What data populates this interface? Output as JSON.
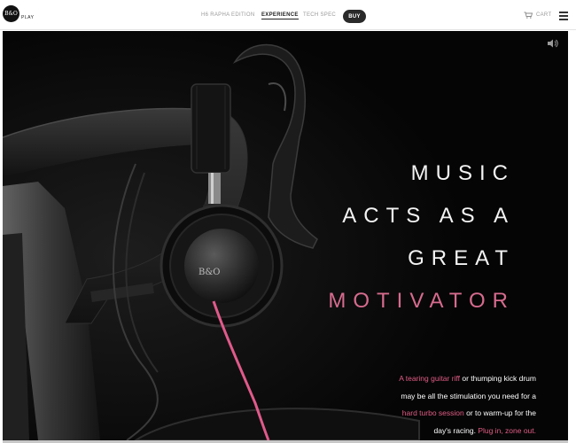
{
  "brand": {
    "logo_mark": "B&O",
    "logo_text": "PLAY"
  },
  "nav": {
    "items": [
      {
        "label": "H6 RAPHA EDITION",
        "active": false
      },
      {
        "label": "EXPERIENCE",
        "active": true
      },
      {
        "label": "TECH SPEC",
        "active": false
      }
    ],
    "buy_label": "BUY",
    "cart_label": "CART"
  },
  "hero": {
    "headline": [
      "MUSIC",
      "ACTS AS A",
      "GREAT",
      "MOTIVATOR"
    ],
    "headline_accent_line": "MOTIVATOR",
    "earcup_logo": "B&O",
    "body_segments": [
      {
        "text": "A tearing guitar riff",
        "accent": true
      },
      {
        "text": " or thumping kick drum",
        "accent": false
      },
      {
        "text": "may be all the stimulation you need for a",
        "accent": false
      },
      {
        "text": "hard turbo session",
        "accent": true
      },
      {
        "text": " or to warm-up for the",
        "accent": false
      },
      {
        "text": "day's racing. ",
        "accent": false
      },
      {
        "text": "Plug in, zone out.",
        "accent": true
      }
    ]
  },
  "icons": {
    "cart": "cart-icon",
    "menu": "hamburger-menu-icon",
    "sound": "speaker-icon"
  },
  "colors": {
    "accent": "#d66b8e",
    "hero_background": "#050505",
    "buy_button": "#2a2a2a"
  }
}
